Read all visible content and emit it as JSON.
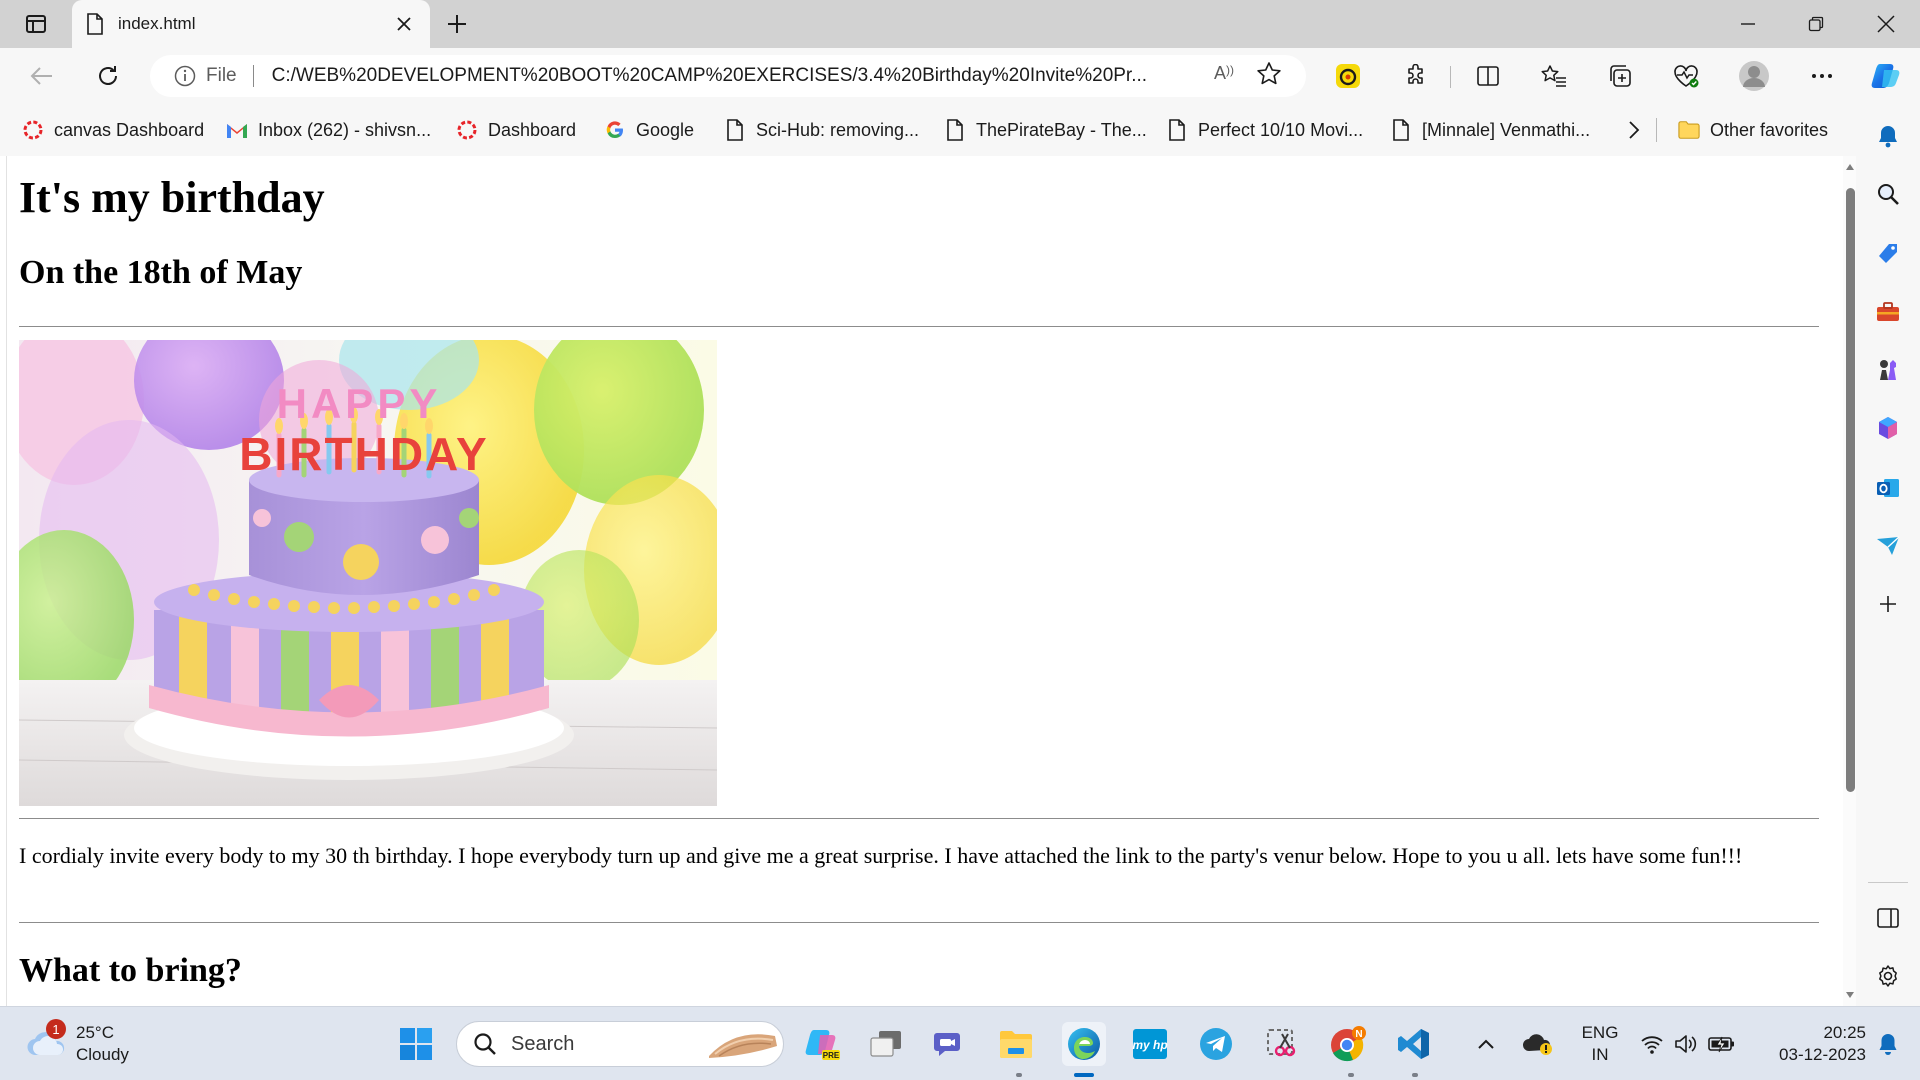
{
  "tab": {
    "title": "index.html"
  },
  "address": {
    "scheme_label": "File",
    "url": "C:/WEB%20DEVELOPMENT%20BOOT%20CAMP%20EXERCISES/3.4%20Birthday%20Invite%20Pr..."
  },
  "favorites": [
    {
      "label": "canvas Dashboard",
      "icon": "canvas-icon"
    },
    {
      "label": "Inbox (262) - shivsn...",
      "icon": "gmail-icon"
    },
    {
      "label": "Dashboard",
      "icon": "canvas-icon"
    },
    {
      "label": "Google",
      "icon": "google-icon"
    },
    {
      "label": "Sci-Hub: removing...",
      "icon": "page-icon"
    },
    {
      "label": "ThePirateBay - The...",
      "icon": "page-icon"
    },
    {
      "label": "Perfect 10/10 Movi...",
      "icon": "page-icon"
    },
    {
      "label": "[Minnale] Venmathi...",
      "icon": "page-icon"
    }
  ],
  "other_favorites": "Other favorites",
  "page": {
    "h1": "It's my birthday",
    "h2_date": "On the 18th of May",
    "cake_text_top": "HAPPY",
    "cake_text_bottom": "BIRTHDAY",
    "paragraph": "I cordialy invite every body to my 30 th birthday. I hope everybody turn up and give me a great surprise. I have attached the link to the party's venur below. Hope to you u all. lets have some fun!!!",
    "h2_bring": "What to bring?"
  },
  "taskbar": {
    "weather_temp": "25°C",
    "weather_cond": "Cloudy",
    "weather_badge": "1",
    "search_label": "Search",
    "lang_top": "ENG",
    "lang_bottom": "IN",
    "time": "20:25",
    "date": "03-12-2023",
    "chrome_badge": "N",
    "copilot_badge": "PRE"
  },
  "colors": {
    "accent": "#0067c0",
    "tab_bg": "#d2d2d2",
    "toolbar_bg": "#f7f7f7",
    "taskbar_bg": "#dfe5ef"
  }
}
